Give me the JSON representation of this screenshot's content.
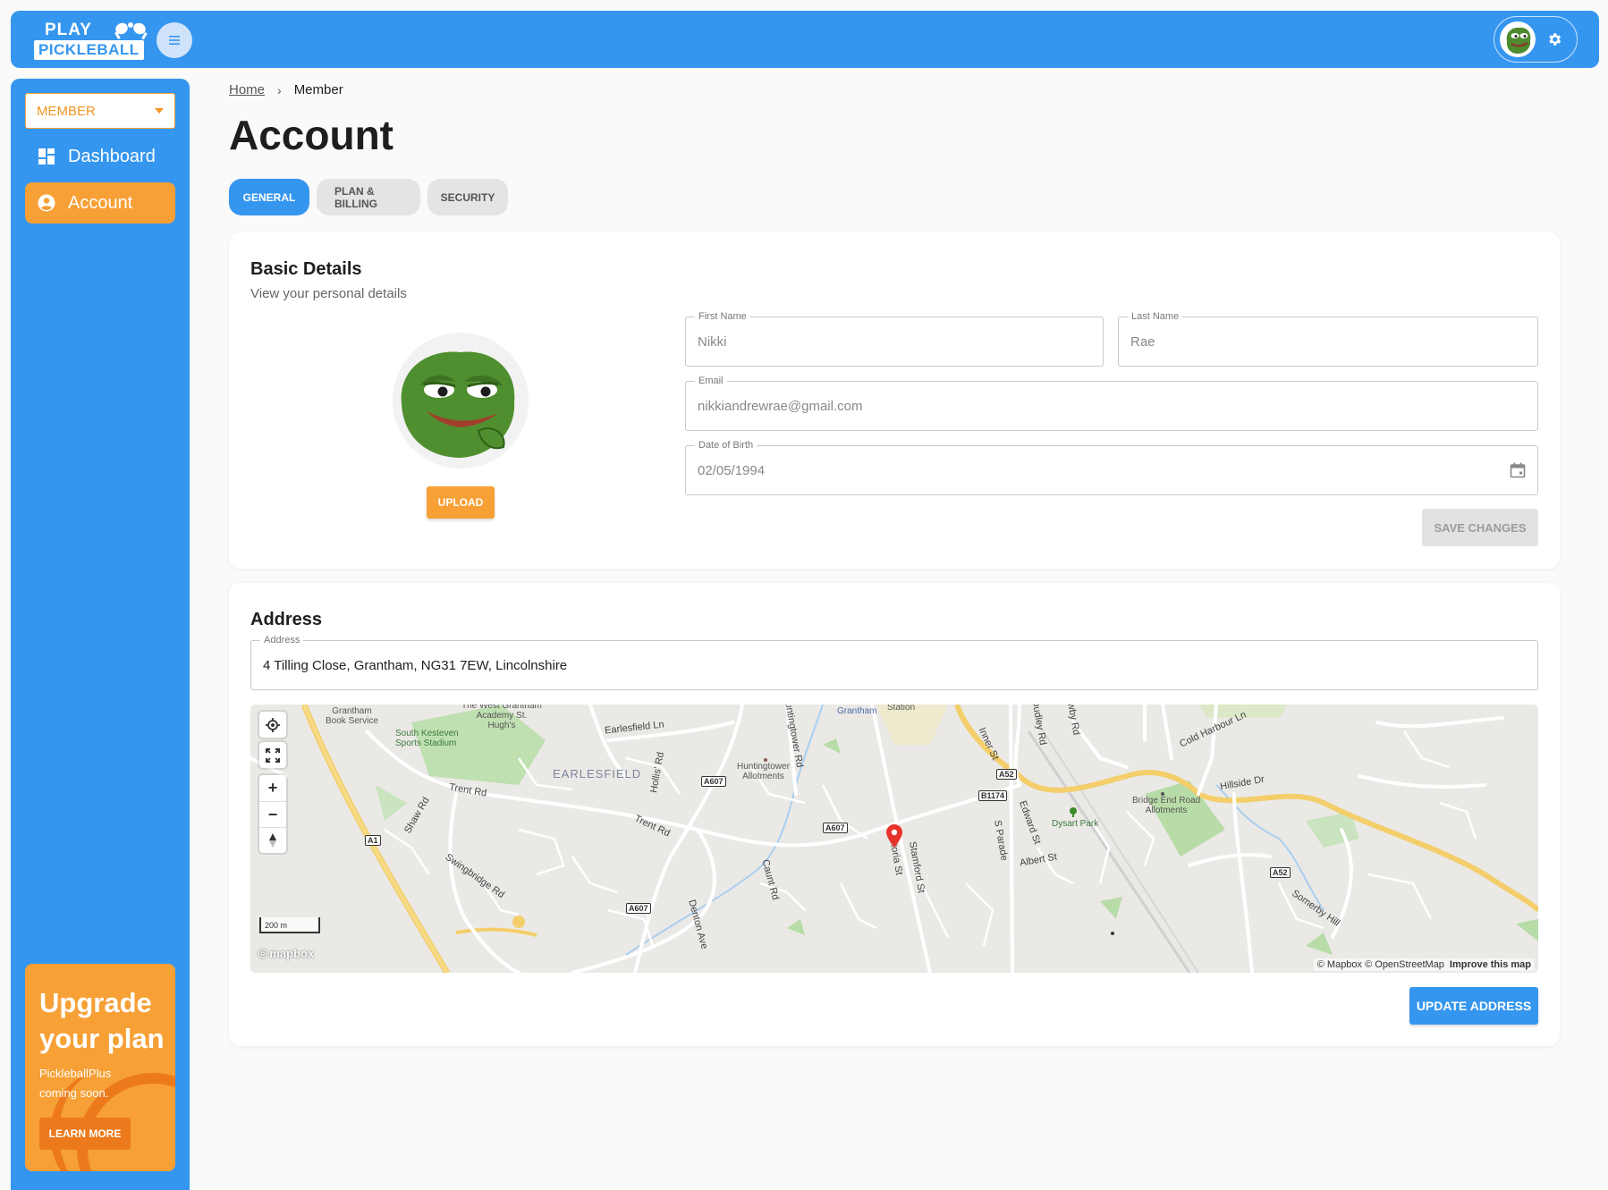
{
  "brand": {
    "line1": "PLAY",
    "line2": "PICKLEBALL"
  },
  "header": {
    "menu_icon": "hamburger-icon",
    "settings_icon": "gear-icon"
  },
  "sidebar": {
    "role_select": "MEMBER",
    "items": [
      {
        "label": "Dashboard",
        "icon": "dashboard-icon",
        "active": false
      },
      {
        "label": "Account",
        "icon": "account-circle-icon",
        "active": true
      }
    ],
    "upgrade": {
      "title": "Upgrade your plan",
      "subtitle": "PickleballPlus coming soon.",
      "button": "LEARN MORE"
    }
  },
  "breadcrumb": {
    "home": "Home",
    "current": "Member"
  },
  "page_title": "Account",
  "tabs": [
    {
      "label": "GENERAL",
      "active": true
    },
    {
      "label": "PLAN & BILLING",
      "active": false
    },
    {
      "label": "SECURITY",
      "active": false
    }
  ],
  "basic_details": {
    "title": "Basic Details",
    "subtitle": "View your personal details",
    "upload_button": "UPLOAD",
    "first_name": {
      "label": "First Name",
      "value": "Nikki"
    },
    "last_name": {
      "label": "Last Name",
      "value": "Rae"
    },
    "email": {
      "label": "Email",
      "value": "nikkiandrewrae@gmail.com"
    },
    "dob": {
      "label": "Date of Birth",
      "value": "02/05/1994"
    },
    "save_button": "SAVE CHANGES"
  },
  "address": {
    "title": "Address",
    "field_label": "Address",
    "value": "4 Tilling Close, Grantham, NG31 7EW, Lincolnshire",
    "update_button": "UPDATE ADDRESS",
    "map": {
      "scale": "200 m",
      "logo": "mapbox",
      "attribution": "© Mapbox © OpenStreetMap",
      "improve": "Improve this map",
      "labels": {
        "grantham_book": "Grantham\nBook Service",
        "south_kesteven": "South Kesteven\nSports Stadium",
        "west_grantham": "The West Grantham\nAcademy St.\nHugh's",
        "earlesfield_ln": "Earlesfield Ln",
        "earlesfield": "EARLESFIELD",
        "trent_rd_1": "Trent Rd",
        "trent_rd_2": "Trent Rd",
        "hollis_rd": "Hollis' Rd",
        "huntingtower_rd": "Huntingtower Rd",
        "huntingtower_allot": "Huntingtower\nAllotments",
        "grantham": "Grantham",
        "station": "Station",
        "shaw_rd": "Shaw Rd",
        "swingbridge_rd": "Swingbridge Rd",
        "caunt_rd": "Caunt Rd",
        "denton_ave": "Denton Ave",
        "victoria_st": "Victoria St",
        "stamford_st": "Stamford St",
        "inner_st": "Inner St",
        "dudley_rd": "Dudley Rd",
        "wby_rd": "wby Rd",
        "s_parade": "S Parade",
        "edward_st": "Edward St",
        "albert_st": "Albert St",
        "dysart_park": "Dysart Park",
        "bridge_end": "Bridge End Road\nAllotments",
        "cold_harbour": "Cold Harbour Ln",
        "hillside_dr": "Hillside Dr",
        "somerby_hill": "Somerby Hill",
        "a1": "A1",
        "a607_1": "A607",
        "a607_2": "A607",
        "a607_3": "A607",
        "a52_1": "A52",
        "a52_2": "A52",
        "b1174": "B1174"
      }
    }
  },
  "colors": {
    "primary": "#3596ef",
    "accent": "#f7a036",
    "accent_dark": "#ec7a1c"
  }
}
